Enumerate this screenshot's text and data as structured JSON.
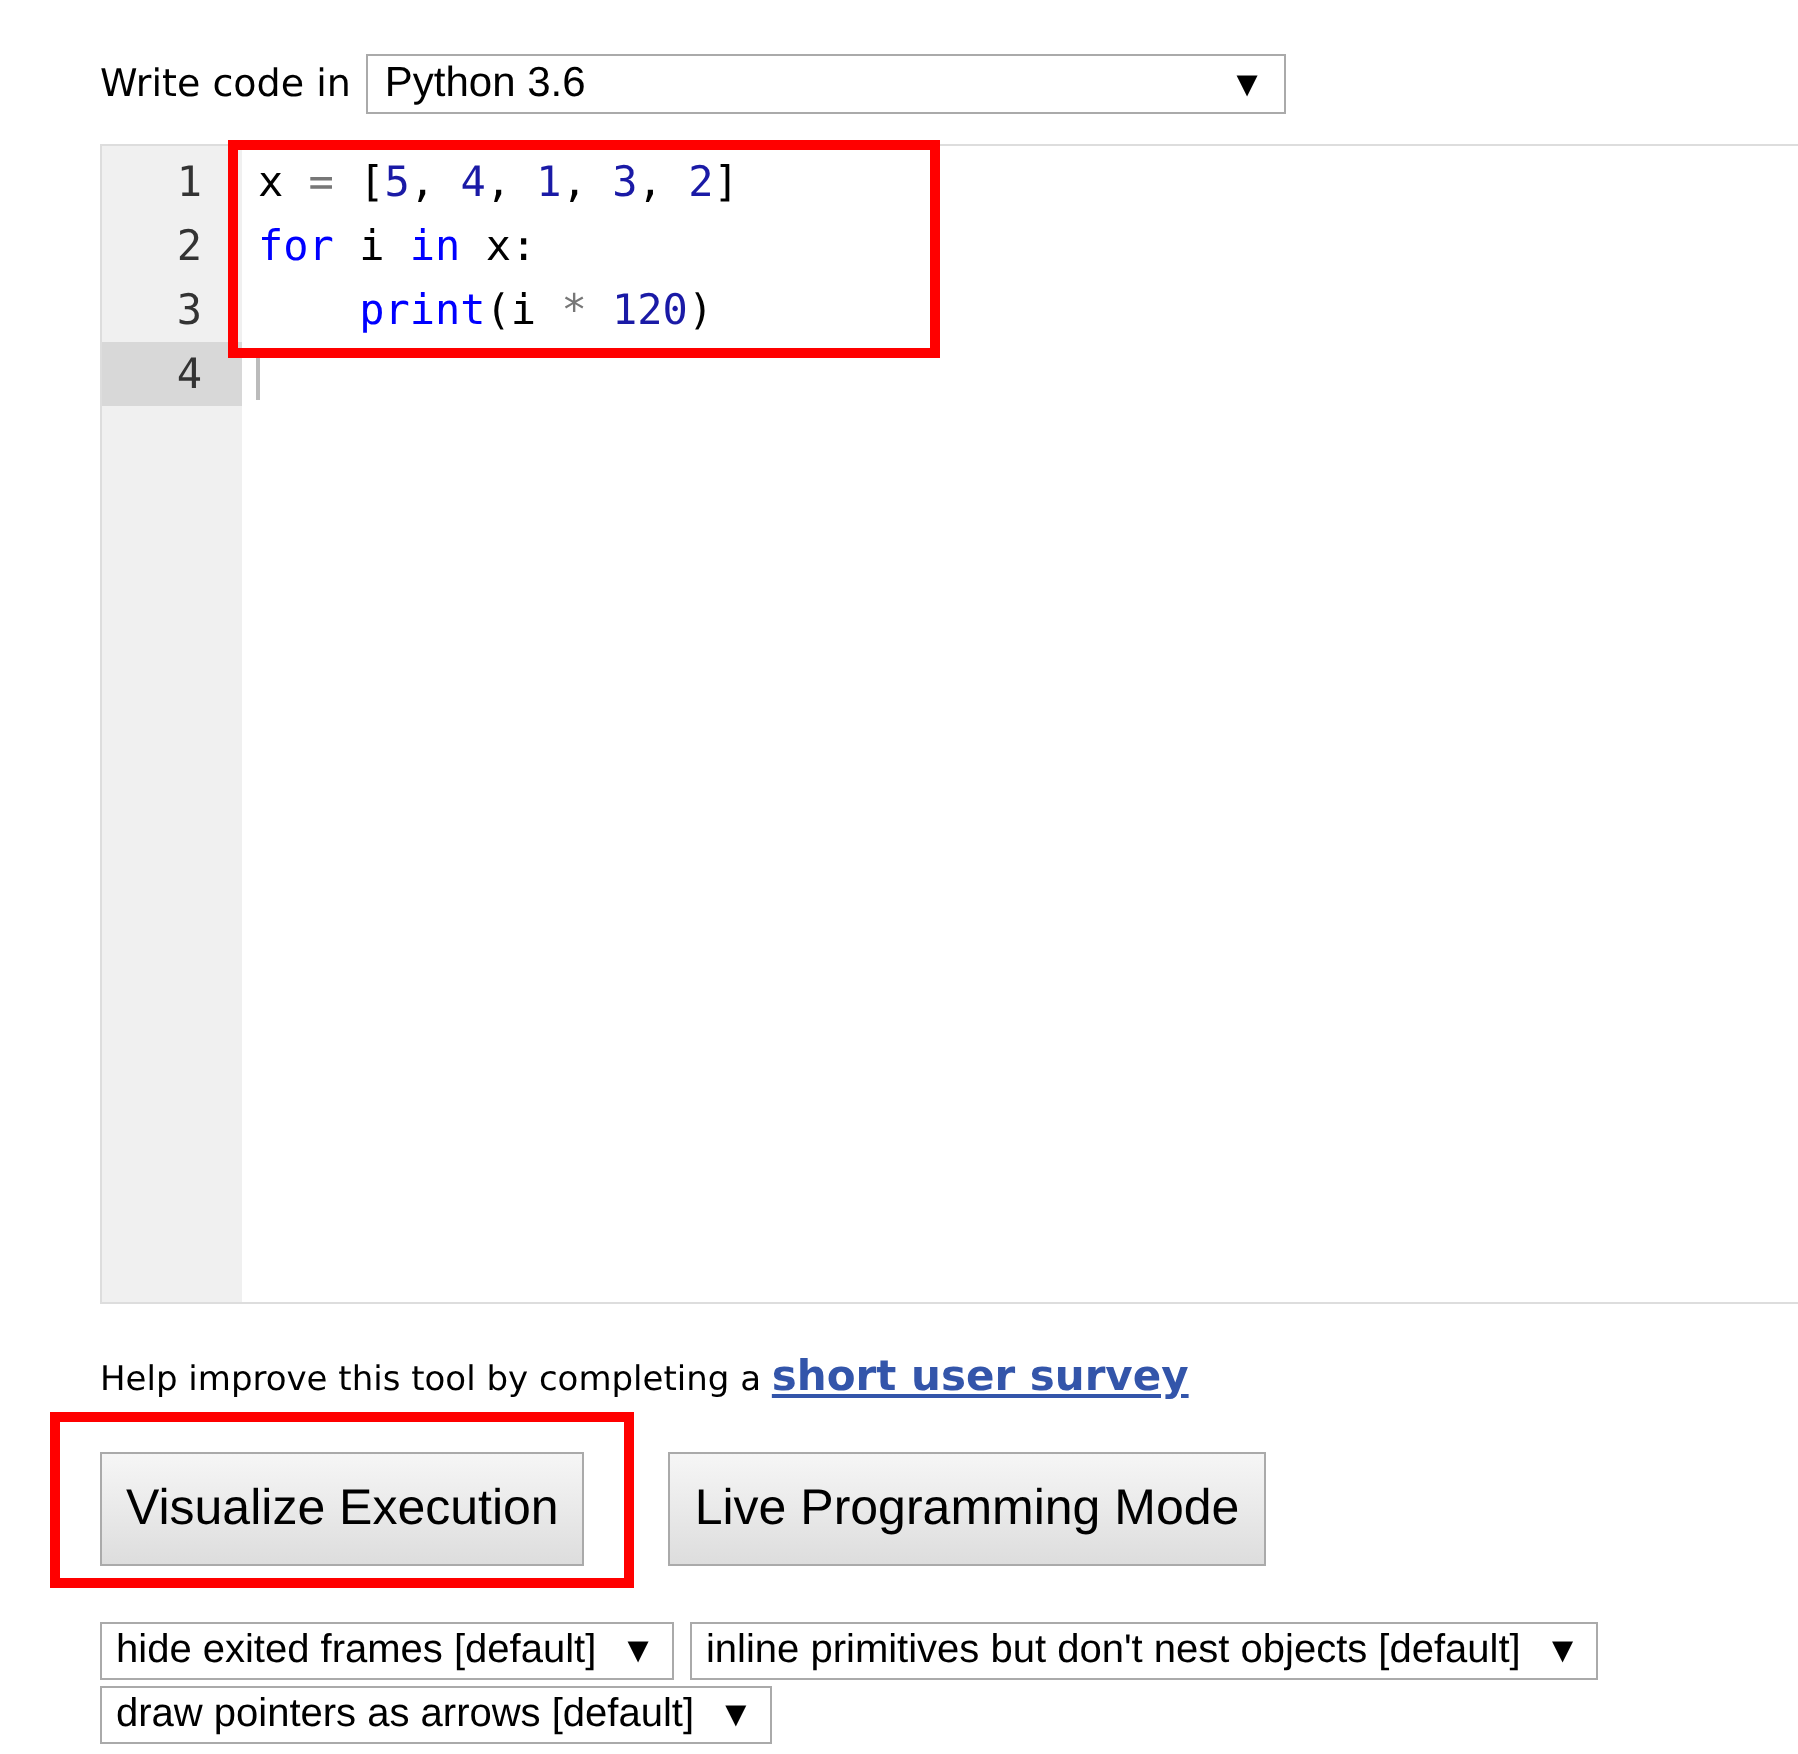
{
  "language_picker": {
    "label": "Write code in",
    "value": "Python 3.6",
    "caret": "▼"
  },
  "code_editor": {
    "highlighted": true,
    "lines": [
      {
        "number": "1",
        "active": false,
        "tokens": [
          {
            "kind": "plain",
            "text": "x "
          },
          {
            "kind": "operator",
            "text": "="
          },
          {
            "kind": "plain",
            "text": " ["
          },
          {
            "kind": "number",
            "text": "5"
          },
          {
            "kind": "plain",
            "text": ", "
          },
          {
            "kind": "number",
            "text": "4"
          },
          {
            "kind": "plain",
            "text": ", "
          },
          {
            "kind": "number",
            "text": "1"
          },
          {
            "kind": "plain",
            "text": ", "
          },
          {
            "kind": "number",
            "text": "3"
          },
          {
            "kind": "plain",
            "text": ", "
          },
          {
            "kind": "number",
            "text": "2"
          },
          {
            "kind": "plain",
            "text": "]"
          }
        ]
      },
      {
        "number": "2",
        "active": false,
        "tokens": [
          {
            "kind": "keyword",
            "text": "for"
          },
          {
            "kind": "plain",
            "text": " i "
          },
          {
            "kind": "keyword",
            "text": "in"
          },
          {
            "kind": "plain",
            "text": " x:"
          }
        ],
        "children": [
          {
            "number": "3",
            "active": false,
            "tokens": [
              {
                "kind": "keyword",
                "text": "print"
              },
              {
                "kind": "plain",
                "text": "(i "
              },
              {
                "kind": "operator",
                "text": "*"
              },
              {
                "kind": "number",
                "text": " 120"
              },
              {
                "kind": "plain",
                "text": ")"
              }
            ]
          }
        ]
      },
      {
        "number": "4",
        "active": true
      }
    ]
  },
  "survey_note": {
    "text": "Help improve this tool by completing a",
    "link": "short user survey"
  },
  "buttons": [
    {
      "label": "Visualize Execution",
      "highlighted": true
    },
    {
      "label": "Live Programming Mode",
      "highlighted": false
    }
  ],
  "options": [
    {
      "value": "hide exited frames [default]",
      "caret": "▼"
    },
    {
      "value": "inline primitives but don't nest objects [default]",
      "caret": "▼"
    },
    {
      "value": "draw pointers as arrows [default]",
      "caret": "▼"
    }
  ]
}
